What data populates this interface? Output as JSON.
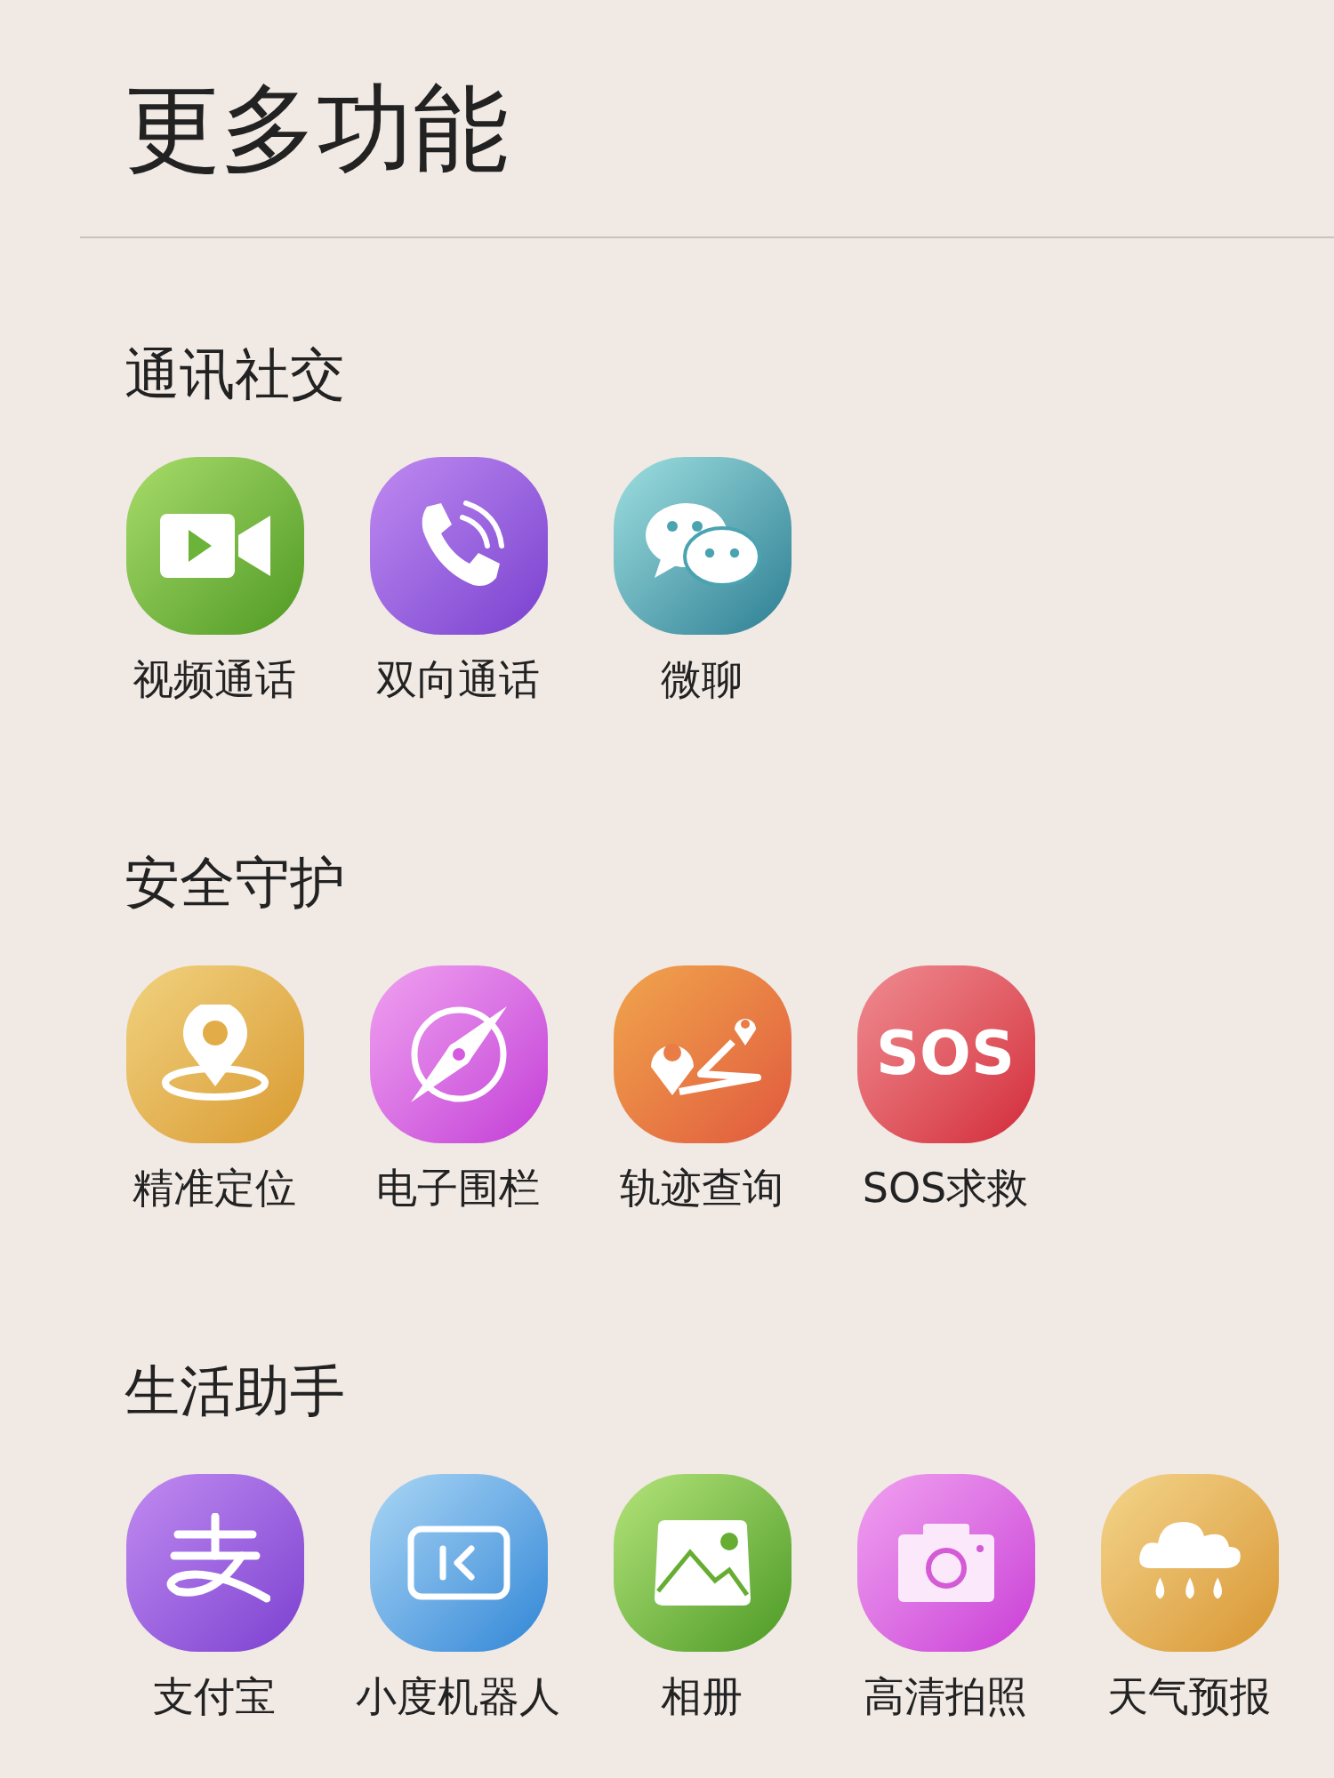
{
  "title": "更多功能",
  "sections": [
    {
      "heading": "通讯社交",
      "items": [
        {
          "label": "视频通话",
          "kind": "video"
        },
        {
          "label": "双向通话",
          "kind": "phone"
        },
        {
          "label": "微聊",
          "kind": "chat"
        }
      ]
    },
    {
      "heading": "安全守护",
      "items": [
        {
          "label": "精准定位",
          "kind": "pin"
        },
        {
          "label": "电子围栏",
          "kind": "compass"
        },
        {
          "label": "轨迹查询",
          "kind": "route"
        },
        {
          "label": "SOS求救",
          "kind": "sos",
          "badge_text": "SOS"
        }
      ]
    },
    {
      "heading": "生活助手",
      "items": [
        {
          "label": "支付宝",
          "kind": "pay"
        },
        {
          "label": "小度机器人",
          "kind": "robot"
        },
        {
          "label": "相册",
          "kind": "photo"
        },
        {
          "label": "高清拍照",
          "kind": "camera"
        },
        {
          "label": "天气预报",
          "kind": "weather"
        }
      ]
    }
  ]
}
